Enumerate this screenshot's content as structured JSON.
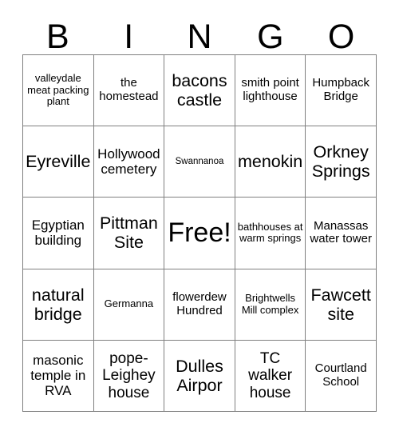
{
  "card": {
    "header_letters": [
      "B",
      "I",
      "N",
      "G",
      "O"
    ],
    "free_space_label": "Free!",
    "rows": [
      [
        {
          "label": "valleydale meat packing plant",
          "size": "sm",
          "free": false
        },
        {
          "label": "the homestead",
          "size": "md",
          "free": false
        },
        {
          "label": "bacons castle",
          "size": "xxl",
          "free": false
        },
        {
          "label": "smith point lighthouse",
          "size": "md",
          "free": false
        },
        {
          "label": "Humpback Bridge",
          "size": "md",
          "free": false
        }
      ],
      [
        {
          "label": "Eyreville",
          "size": "xxl",
          "free": false
        },
        {
          "label": "Hollywood cemetery",
          "size": "lg",
          "free": false
        },
        {
          "label": "Swannanoa",
          "size": "xs",
          "free": false
        },
        {
          "label": "menokin",
          "size": "xxl",
          "free": false
        },
        {
          "label": "Orkney Springs",
          "size": "xxl",
          "free": false
        }
      ],
      [
        {
          "label": "Egyptian building",
          "size": "lg",
          "free": false
        },
        {
          "label": "Pittman Site",
          "size": "xxl",
          "free": false
        },
        {
          "label": "Free!",
          "size": "free",
          "free": true
        },
        {
          "label": "bathhouses at warm springs",
          "size": "sm",
          "free": false
        },
        {
          "label": "Manassas water tower",
          "size": "md",
          "free": false
        }
      ],
      [
        {
          "label": "natural bridge",
          "size": "xxl",
          "free": false
        },
        {
          "label": "Germanna",
          "size": "sm",
          "free": false
        },
        {
          "label": "flowerdew Hundred",
          "size": "md",
          "free": false
        },
        {
          "label": "Brightwells Mill complex",
          "size": "sm",
          "free": false
        },
        {
          "label": "Fawcett site",
          "size": "xxl",
          "free": false
        }
      ],
      [
        {
          "label": "masonic temple in RVA",
          "size": "lg",
          "free": false
        },
        {
          "label": "pope-Leighey house",
          "size": "xl",
          "free": false
        },
        {
          "label": "Dulles Airpor",
          "size": "xxl",
          "free": false
        },
        {
          "label": "TC walker house",
          "size": "xl",
          "free": false
        },
        {
          "label": "Courtland School",
          "size": "md",
          "free": false
        }
      ]
    ]
  },
  "colors": {
    "background": "#ffffff",
    "text": "#000000",
    "grid_line": "#808080"
  }
}
